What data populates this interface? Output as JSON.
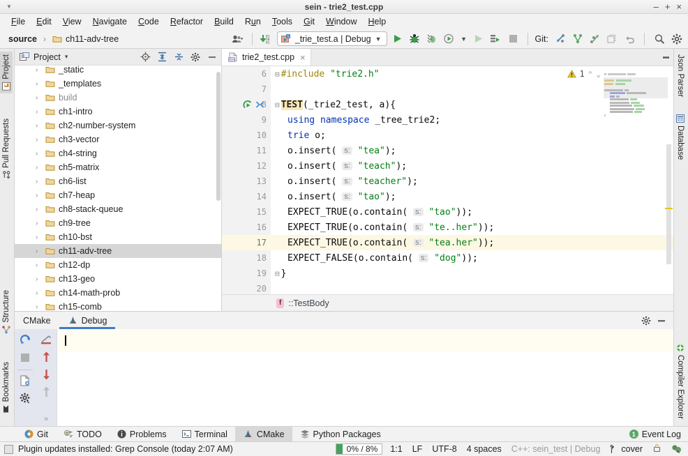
{
  "window": {
    "title": "sein - trie2_test.cpp",
    "minimize": "–",
    "maximize": "+",
    "close": "×"
  },
  "menubar": {
    "items": [
      "File",
      "Edit",
      "View",
      "Navigate",
      "Code",
      "Refactor",
      "Build",
      "Run",
      "Tools",
      "Git",
      "Window",
      "Help"
    ]
  },
  "toolbar": {
    "breadcrumb_root": "source",
    "breadcrumb_sep": "›",
    "breadcrumb_folder": "ch11-adv-tree",
    "run_config": "_trie_test.a | Debug",
    "git_label": "Git:",
    "icons": {
      "avatar": "avatar-icon",
      "updates": "download-updates-icon",
      "run": "run-icon",
      "debug": "debug-icon",
      "coverage": "run-with-coverage-icon",
      "profile": "profile-icon",
      "rerun": "rerun-icon",
      "build": "build-icon",
      "stop": "stop-icon",
      "update_project": "git-update-icon",
      "commit": "git-commit-icon",
      "push": "git-push-icon",
      "history": "git-history-icon",
      "rollback": "git-rollback-icon",
      "search": "search-icon",
      "settings": "settings-icon"
    }
  },
  "left_strip": {
    "tabs": [
      "Project",
      "Pull Requests",
      "Structure",
      "Bookmarks"
    ],
    "selected": "Project"
  },
  "right_strip": {
    "tabs": [
      "Json Parser",
      "Database",
      "Compiler Explorer"
    ]
  },
  "project_panel": {
    "title": "Project",
    "dropdown": "▾",
    "tree": [
      {
        "label": "_static",
        "dim": false
      },
      {
        "label": "_templates",
        "dim": false
      },
      {
        "label": "build",
        "dim": true
      },
      {
        "label": "ch1-intro",
        "dim": false
      },
      {
        "label": "ch2-number-system",
        "dim": false
      },
      {
        "label": "ch3-vector",
        "dim": false
      },
      {
        "label": "ch4-string",
        "dim": false
      },
      {
        "label": "ch5-matrix",
        "dim": false
      },
      {
        "label": "ch6-list",
        "dim": false
      },
      {
        "label": "ch7-heap",
        "dim": false
      },
      {
        "label": "ch8-stack-queue",
        "dim": false
      },
      {
        "label": "ch9-tree",
        "dim": false
      },
      {
        "label": "ch10-bst",
        "dim": false
      },
      {
        "label": "ch11-adv-tree",
        "dim": false,
        "selected": true
      },
      {
        "label": "ch12-dp",
        "dim": false
      },
      {
        "label": "ch13-geo",
        "dim": false
      },
      {
        "label": "ch14-math-prob",
        "dim": false
      },
      {
        "label": "ch15-comb",
        "dim": false
      }
    ],
    "expand_arrow": "›"
  },
  "editor": {
    "tab_name": "trie2_test.cpp",
    "tab_close": "×",
    "warning_count": "1",
    "chevron_up": "⌃",
    "chevron_down": "⌄",
    "breadcrumb_fn_badge": "f",
    "breadcrumb_fn": "::TestBody",
    "lines": [
      {
        "num": "6",
        "current": false
      },
      {
        "num": "7",
        "current": false
      },
      {
        "num": "8",
        "current": false
      },
      {
        "num": "9",
        "current": false
      },
      {
        "num": "10",
        "current": false
      },
      {
        "num": "11",
        "current": false
      },
      {
        "num": "12",
        "current": false
      },
      {
        "num": "13",
        "current": false
      },
      {
        "num": "14",
        "current": false
      },
      {
        "num": "15",
        "current": false
      },
      {
        "num": "16",
        "current": false
      },
      {
        "num": "17",
        "current": true
      },
      {
        "num": "18",
        "current": false
      },
      {
        "num": "19",
        "current": false
      },
      {
        "num": "20",
        "current": false
      }
    ],
    "code": {
      "l6_include": "#include",
      "l6_header": "\"trie2.h\"",
      "l8_test": "TEST",
      "l8_rest": "(_trie2_test, a){",
      "l9_using": "using namespace",
      "l9_ns": " _tree_trie2;",
      "l10_type": "trie",
      "l10_var": " o;",
      "l11_call": "o.insert(",
      "l11_hint": "s:",
      "l11_arg": "\"tea\"",
      "l11_end": ");",
      "l12_call": "o.insert(",
      "l12_hint": "s:",
      "l12_arg": "\"teach\"",
      "l12_end": ");",
      "l13_call": "o.insert(",
      "l13_hint": "s:",
      "l13_arg": "\"teacher\"",
      "l13_end": ");",
      "l14_call": "o.insert(",
      "l14_hint": "s:",
      "l14_arg": "\"tao\"",
      "l14_end": ");",
      "l15_call": "EXPECT_TRUE(o.contain(",
      "l15_hint": "s:",
      "l15_arg": "\"tao\"",
      "l15_end": "));",
      "l16_call": "EXPECT_TRUE(o.contain(",
      "l16_hint": "s:",
      "l16_arg": "\"te..her\"",
      "l16_end": "));",
      "l17_call": "EXPECT_TRUE(o.contain(",
      "l17_hint": "s:",
      "l17_arg": "\"tea.her\"",
      "l17_end": "));",
      "l18_call": "EXPECT_FALSE(o.contain(",
      "l18_hint": "s:",
      "l18_arg": "\"dog\"",
      "l18_end": "));",
      "l19_brace": "}"
    }
  },
  "bottom_panel": {
    "tabs": [
      {
        "label": "CMake",
        "active": false
      },
      {
        "label": "Debug",
        "active": true
      }
    ],
    "tools": [
      "rerun-icon",
      "soft-wrap-icon",
      "stop-icon",
      "up-icon",
      "export-icon",
      "down-icon",
      "settings-icon",
      "up-disabled-icon"
    ],
    "expand": "»"
  },
  "tool_strip": {
    "items": [
      {
        "label": "Git",
        "icon": "git-icon",
        "selected": false
      },
      {
        "label": "TODO",
        "icon": "todo-icon",
        "selected": false
      },
      {
        "label": "Problems",
        "icon": "problems-icon",
        "selected": false
      },
      {
        "label": "Terminal",
        "icon": "terminal-icon",
        "selected": false
      },
      {
        "label": "CMake",
        "icon": "cmake-icon",
        "selected": true
      },
      {
        "label": "Python Packages",
        "icon": "python-icon",
        "selected": false
      }
    ],
    "event_log": "Event Log",
    "event_count": "1"
  },
  "status_bar": {
    "message": "Plugin updates installed: Grep Console (today 2:07 AM)",
    "memory": "0% /  8%",
    "caret": "1:1",
    "line_sep": "LF",
    "encoding": "UTF-8",
    "indent": "4 spaces",
    "context": "C++: sein_test | Debug",
    "branch": "cover",
    "branch_icon": "git-branch-icon",
    "lock_icon": "lock-icon",
    "inspect_icon": "inspections-icon"
  },
  "colors": {
    "accent_blue": "#3d7cc9",
    "green": "#59a869",
    "string_green": "#067d17",
    "keyword_blue": "#0033b3",
    "preproc_yellow": "#9e880d",
    "highlight_line": "#fdf8e3",
    "selection_gray": "#d6d6d6"
  }
}
